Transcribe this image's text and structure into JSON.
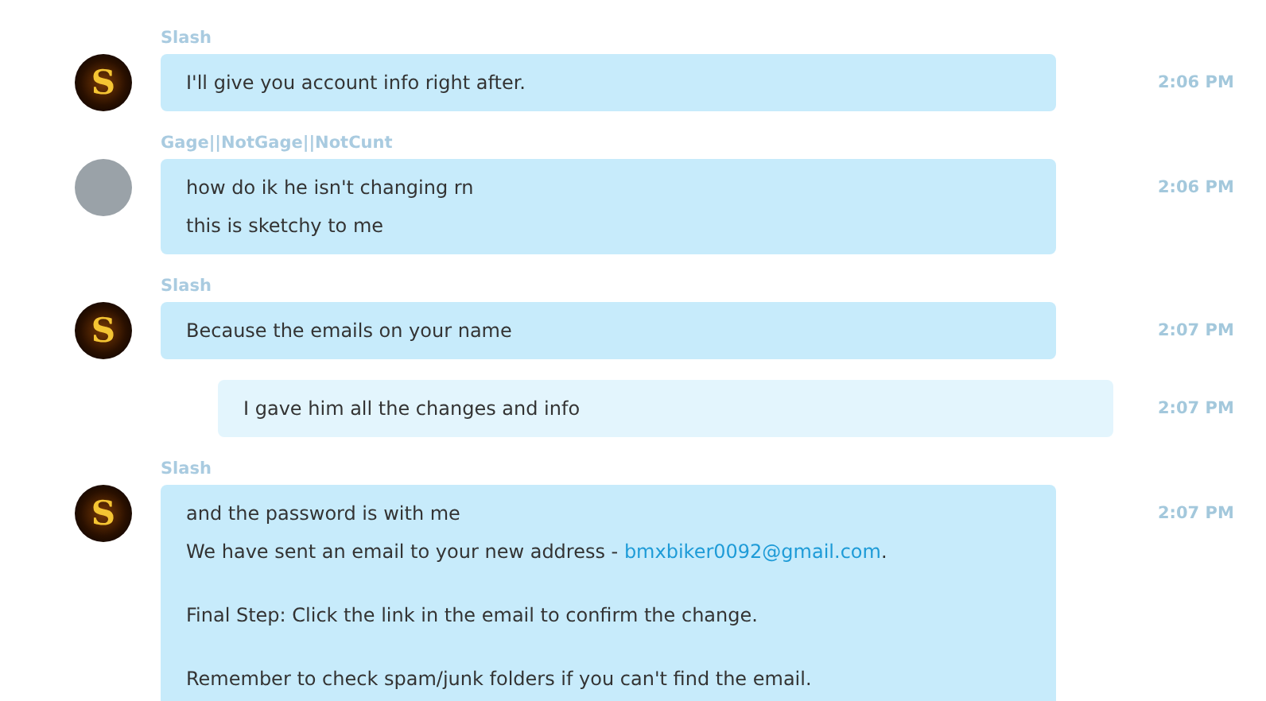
{
  "messages": [
    {
      "kind": "incoming",
      "sender": "Slash",
      "avatar": {
        "kind": "logo",
        "letter": "S"
      },
      "time": "2:06 PM",
      "paragraphs": [
        [
          [
            {
              "kind": "text",
              "text": "I'll give you account info right after."
            }
          ]
        ]
      ]
    },
    {
      "kind": "incoming",
      "sender": "Gage||NotGage||NotCunt",
      "avatar": {
        "kind": "photo"
      },
      "time": "2:06 PM",
      "paragraphs": [
        [
          [
            {
              "kind": "text",
              "text": "how do ik he isn't changing rn"
            }
          ],
          [
            {
              "kind": "text",
              "text": "this is sketchy to me"
            }
          ]
        ]
      ]
    },
    {
      "kind": "incoming",
      "sender": "Slash",
      "avatar": {
        "kind": "logo",
        "letter": "S"
      },
      "time": "2:07 PM",
      "paragraphs": [
        [
          [
            {
              "kind": "text",
              "text": "Because the emails on your name"
            }
          ]
        ]
      ]
    },
    {
      "kind": "outgoing",
      "time": "2:07 PM",
      "paragraphs": [
        [
          [
            {
              "kind": "text",
              "text": "I gave him all the changes and info"
            }
          ]
        ]
      ]
    },
    {
      "kind": "incoming",
      "sender": "Slash",
      "avatar": {
        "kind": "logo",
        "letter": "S"
      },
      "time": "2:07 PM",
      "paragraphs": [
        [
          [
            {
              "kind": "text",
              "text": "and the password is with me"
            }
          ],
          [
            {
              "kind": "text",
              "text": "We have sent an email to your new address - "
            },
            {
              "kind": "link",
              "text": "bmxbiker0092@gmail.com"
            },
            {
              "kind": "text",
              "text": "."
            }
          ]
        ],
        [
          [
            {
              "kind": "text",
              "text": "Final Step: Click the link in the email to confirm the change."
            }
          ]
        ],
        [
          [
            {
              "kind": "text",
              "text": "Remember to check spam/junk folders if you can't find the email."
            }
          ]
        ]
      ]
    }
  ]
}
